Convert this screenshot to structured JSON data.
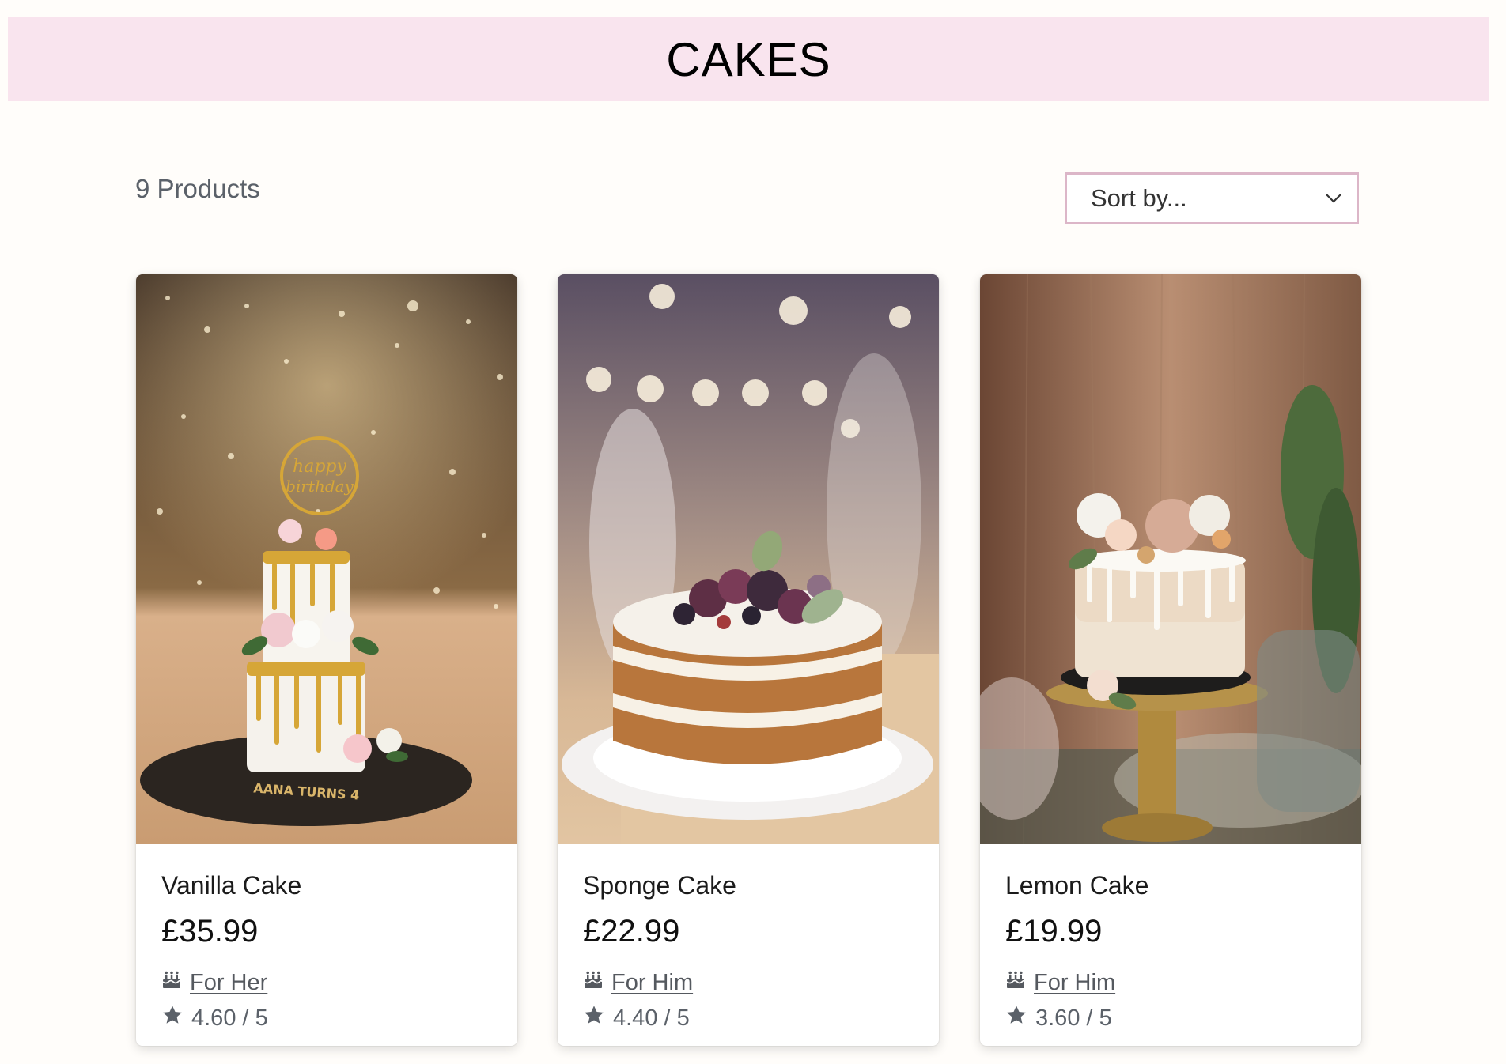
{
  "header": {
    "title": "CAKES"
  },
  "toolbar": {
    "product_count": "9 Products",
    "sort_placeholder": "Sort by..."
  },
  "products": [
    {
      "name": "Vanilla Cake",
      "price": "£35.99",
      "category": "For Her",
      "rating": "4.60 / 5",
      "image": "two-tier white drip cake with gold drip, roses and happy birthday topper"
    },
    {
      "name": "Sponge Cake",
      "price": "£22.99",
      "category": "For Him",
      "rating": "4.40 / 5",
      "image": "naked layered sponge cake topped with figs and berries"
    },
    {
      "name": "Lemon Cake",
      "price": "£19.99",
      "category": "For Him",
      "rating": "3.60 / 5",
      "image": "white drip cake with flowers on a gold cake stand"
    }
  ],
  "icons": {
    "category_icon": "birthday-cake-icon",
    "rating_icon": "star-icon",
    "sort_chevron": "chevron-down-icon"
  },
  "colors": {
    "banner_bg": "#f9e4ee",
    "sort_border": "#dcb6c8",
    "page_bg": "#fffdfa"
  }
}
